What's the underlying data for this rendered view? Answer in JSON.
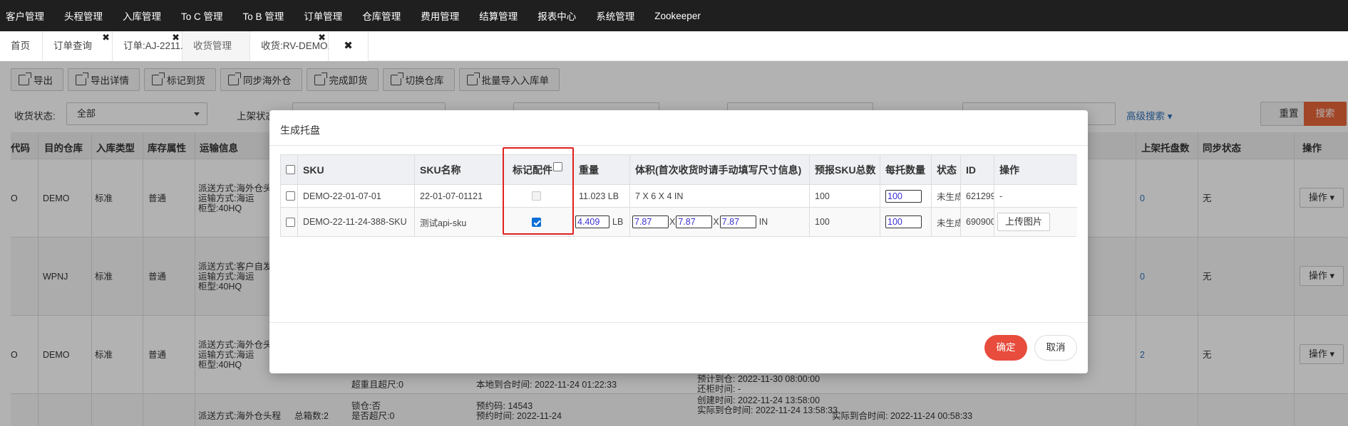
{
  "nav": {
    "items": [
      "客户管理",
      "头程管理",
      "入库管理",
      "To C 管理",
      "To B 管理",
      "订单管理",
      "仓库管理",
      "费用管理",
      "结算管理",
      "报表中心",
      "系统管理",
      "Zookeeper"
    ]
  },
  "tabs": [
    {
      "label": "首页",
      "closable": false
    },
    {
      "label": "订单查询",
      "closable": true
    },
    {
      "label": "订单:AJ-2211...",
      "closable": true
    },
    {
      "label": "收货管理",
      "closable": false,
      "active": true
    },
    {
      "label": "收货:RV-DEMO...",
      "closable": true
    },
    {
      "label": "",
      "closable": true
    }
  ],
  "close_glyph": "✖",
  "toolbar": {
    "buttons": [
      "导出",
      "导出详情",
      "标记到货",
      "同步海外仓",
      "完成卸货",
      "切换仓库",
      "批量导入入库单"
    ]
  },
  "filters": {
    "status_label": "收货状态:",
    "status_value": "全部",
    "shelf_label": "上架状态",
    "adv_search": "高级搜索",
    "reset": "重置",
    "search": "搜索"
  },
  "bg_table": {
    "headers": {
      "code": "代码",
      "warehouse": "目的仓库",
      "type": "入库类型",
      "attr": "库存属性",
      "transport": "运输信息",
      "pallets": "上架托盘数",
      "sync": "同步状态",
      "ops": "操作"
    },
    "rows": [
      {
        "code": "O",
        "warehouse": "DEMO",
        "type": "标准",
        "attr": "普通",
        "t1": "派送方式:海外仓头",
        "t2": "运输方式:海运",
        "t3": "柜型:40HQ",
        "pallets": "0",
        "sync": "无",
        "op": "操作"
      },
      {
        "code": "",
        "warehouse": "WPNJ",
        "type": "标准",
        "attr": "普通",
        "t1": "派送方式:客户自发",
        "t2": "运输方式:海运",
        "t3": "柜型:40HQ",
        "pallets": "0",
        "sync": "无",
        "op": "操作"
      },
      {
        "code": "O",
        "warehouse": "DEMO",
        "type": "标准",
        "attr": "普通",
        "t1": "派送方式:海外仓头",
        "t2": "运输方式:海运",
        "t3": "柜型:40HQ",
        "pallets": "2",
        "sync": "无",
        "op": "操作"
      },
      {
        "code": "",
        "warehouse": "",
        "type": "",
        "attr": "",
        "t1": "派送方式:海外仓头程",
        "t2": "",
        "t3": "",
        "pallets": "",
        "sync": "",
        "op": ""
      }
    ],
    "extra": {
      "overweight": "超重且超尺:0",
      "local_time": "本地到合时间: 2022-11-24 01:22:33",
      "eta_line": "预计到仓: 2022-11-30 08:00:00",
      "return_time": "还柜时间: -",
      "lock": "锁仓:否",
      "over_size": "是否超尺:0",
      "total": "总箱数:2",
      "appt_code": "预约码: 14543",
      "appt_time": "预约时间: 2022-11-24",
      "created": "创建时间: 2022-11-24 13:58:00",
      "actual_arrive": "实际到仓时间: 2022-11-24 13:58:33",
      "actual_arrive2": "实际到合时间: 2022-11-24 00:58:33"
    }
  },
  "modal": {
    "title": "生成托盘",
    "headers": {
      "sku": "SKU",
      "sku_name": "SKU名称",
      "mark_part": "标记配件",
      "weight": "重量",
      "volume": "体积(首次收货时请手动填写尺寸信息)",
      "forecast": "预报SKU总数",
      "per_pallet": "每托数量",
      "status": "状态",
      "id": "ID",
      "ops": "操作"
    },
    "rows": [
      {
        "sku": "DEMO-22-01-07-01",
        "sku_name": "22-01-07-01121",
        "mark_part_checked": false,
        "mark_part_disabled": true,
        "weight": "11.023 LB",
        "volume": "7 X 6 X 4 IN",
        "forecast": "100",
        "per_pallet": "100",
        "status": "未生成",
        "id": "621299",
        "op": "-"
      },
      {
        "sku": "DEMO-22-11-24-388-SKU",
        "sku_name": "测试api-sku",
        "mark_part_checked": true,
        "mark_part_disabled": false,
        "weight_value": "4.409",
        "weight_unit": "LB",
        "dim_l": "7.87",
        "dim_w": "7.87",
        "dim_h": "7.87",
        "dim_sep": "X",
        "dim_unit": "IN",
        "forecast": "100",
        "per_pallet": "100",
        "status": "未生成",
        "id": "690900",
        "op": "上传图片"
      }
    ],
    "confirm": "确定",
    "cancel": "取消"
  },
  "colors": {
    "nav_bg": "#1f1f1f",
    "accent_orange": "#e8653a",
    "confirm_red": "#e74c3c",
    "highlight_red": "#e02020",
    "link_blue": "#2f6fb8"
  }
}
